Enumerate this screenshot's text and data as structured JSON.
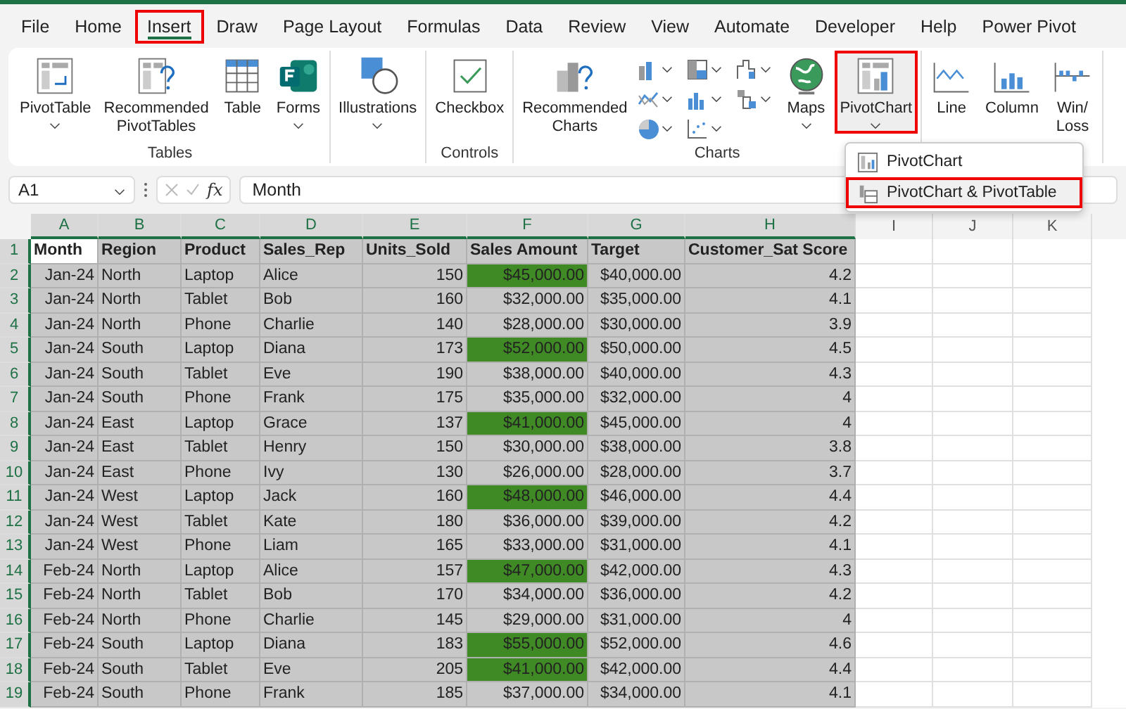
{
  "tabs": [
    {
      "label": "File",
      "selected": false,
      "annotated": false
    },
    {
      "label": "Home",
      "selected": false,
      "annotated": false
    },
    {
      "label": "Insert",
      "selected": true,
      "annotated": true
    },
    {
      "label": "Draw",
      "selected": false,
      "annotated": false
    },
    {
      "label": "Page Layout",
      "selected": false,
      "annotated": false
    },
    {
      "label": "Formulas",
      "selected": false,
      "annotated": false
    },
    {
      "label": "Data",
      "selected": false,
      "annotated": false
    },
    {
      "label": "Review",
      "selected": false,
      "annotated": false
    },
    {
      "label": "View",
      "selected": false,
      "annotated": false
    },
    {
      "label": "Automate",
      "selected": false,
      "annotated": false
    },
    {
      "label": "Developer",
      "selected": false,
      "annotated": false
    },
    {
      "label": "Help",
      "selected": false,
      "annotated": false
    },
    {
      "label": "Power Pivot",
      "selected": false,
      "annotated": false
    }
  ],
  "ribbon": {
    "groups": [
      {
        "label": "Tables",
        "buttons": [
          {
            "label": "PivotTable",
            "dropdown": true,
            "annotated": false
          },
          {
            "label": "Recommended PivotTables",
            "dropdown": false,
            "annotated": false
          },
          {
            "label": "Table",
            "dropdown": false,
            "annotated": false
          },
          {
            "label": "Forms",
            "dropdown": true,
            "annotated": false
          }
        ]
      },
      {
        "buttons": [
          {
            "label": "Illustrations",
            "dropdown": true,
            "annotated": false
          }
        ]
      },
      {
        "label": "Controls",
        "buttons": [
          {
            "label": "Checkbox",
            "dropdown": false,
            "annotated": false
          }
        ]
      },
      {
        "label": "Charts",
        "buttons": [
          {
            "label": "Recommended Charts",
            "dropdown": false,
            "annotated": false
          },
          {
            "kind": "chart-grid"
          },
          {
            "label": "Maps",
            "dropdown": true,
            "annotated": false
          },
          {
            "label": "PivotChart",
            "dropdown": true,
            "annotated": true
          }
        ]
      },
      {
        "buttons": [
          {
            "label": "Line",
            "dropdown": false,
            "annotated": false
          },
          {
            "label": "Column",
            "dropdown": false,
            "annotated": false
          },
          {
            "label": "Win/ Loss",
            "dropdown": false,
            "annotated": false
          }
        ]
      }
    ]
  },
  "menu": {
    "items": [
      {
        "label": "PivotChart",
        "selected": false,
        "annotated": false
      },
      {
        "label": "PivotChart & PivotTable",
        "selected": true,
        "annotated": true
      }
    ]
  },
  "formula_bar": {
    "name_box": "A1",
    "function_label": "fx",
    "formula": "Month"
  },
  "sheet": {
    "columns": [
      {
        "letter": "A",
        "selected": true,
        "numeric": true
      },
      {
        "letter": "B",
        "selected": true,
        "numeric": false
      },
      {
        "letter": "C",
        "selected": true,
        "numeric": false
      },
      {
        "letter": "D",
        "selected": true,
        "numeric": false
      },
      {
        "letter": "E",
        "selected": true,
        "numeric": true
      },
      {
        "letter": "F",
        "selected": true,
        "numeric": true
      },
      {
        "letter": "G",
        "selected": true,
        "numeric": true
      },
      {
        "letter": "H",
        "selected": true,
        "numeric": true
      },
      {
        "letter": "I",
        "selected": false
      },
      {
        "letter": "J",
        "selected": false
      },
      {
        "letter": "K",
        "selected": false
      }
    ],
    "rows": [
      {
        "number": "1",
        "selected": true,
        "header": true,
        "active_first": true,
        "highlight_sales": false,
        "cells": [
          "Month",
          "Region",
          "Product",
          "Sales_Rep",
          "Units_Sold",
          "Sales Amount",
          "Target",
          "Customer_Sat Score"
        ]
      },
      {
        "number": "2",
        "selected": true,
        "header": false,
        "active_first": false,
        "highlight_sales": true,
        "cells": [
          "Jan-24",
          "North",
          "Laptop",
          "Alice",
          "150",
          "$45,000.00",
          "$40,000.00",
          "4.2"
        ]
      },
      {
        "number": "3",
        "selected": true,
        "header": false,
        "active_first": false,
        "highlight_sales": false,
        "cells": [
          "Jan-24",
          "North",
          "Tablet",
          "Bob",
          "160",
          "$32,000.00",
          "$35,000.00",
          "4.1"
        ]
      },
      {
        "number": "4",
        "selected": true,
        "header": false,
        "active_first": false,
        "highlight_sales": false,
        "cells": [
          "Jan-24",
          "North",
          "Phone",
          "Charlie",
          "140",
          "$28,000.00",
          "$30,000.00",
          "3.9"
        ]
      },
      {
        "number": "5",
        "selected": true,
        "header": false,
        "active_first": false,
        "highlight_sales": true,
        "cells": [
          "Jan-24",
          "South",
          "Laptop",
          "Diana",
          "173",
          "$52,000.00",
          "$50,000.00",
          "4.5"
        ]
      },
      {
        "number": "6",
        "selected": true,
        "header": false,
        "active_first": false,
        "highlight_sales": false,
        "cells": [
          "Jan-24",
          "South",
          "Tablet",
          "Eve",
          "190",
          "$38,000.00",
          "$40,000.00",
          "4.3"
        ]
      },
      {
        "number": "7",
        "selected": true,
        "header": false,
        "active_first": false,
        "highlight_sales": false,
        "cells": [
          "Jan-24",
          "South",
          "Phone",
          "Frank",
          "175",
          "$35,000.00",
          "$32,000.00",
          "4"
        ]
      },
      {
        "number": "8",
        "selected": true,
        "header": false,
        "active_first": false,
        "highlight_sales": true,
        "cells": [
          "Jan-24",
          "East",
          "Laptop",
          "Grace",
          "137",
          "$41,000.00",
          "$45,000.00",
          "4"
        ]
      },
      {
        "number": "9",
        "selected": true,
        "header": false,
        "active_first": false,
        "highlight_sales": false,
        "cells": [
          "Jan-24",
          "East",
          "Tablet",
          "Henry",
          "150",
          "$30,000.00",
          "$38,000.00",
          "3.8"
        ]
      },
      {
        "number": "10",
        "selected": true,
        "header": false,
        "active_first": false,
        "highlight_sales": false,
        "cells": [
          "Jan-24",
          "East",
          "Phone",
          "Ivy",
          "130",
          "$26,000.00",
          "$28,000.00",
          "3.7"
        ]
      },
      {
        "number": "11",
        "selected": true,
        "header": false,
        "active_first": false,
        "highlight_sales": true,
        "cells": [
          "Jan-24",
          "West",
          "Laptop",
          "Jack",
          "160",
          "$48,000.00",
          "$46,000.00",
          "4.4"
        ]
      },
      {
        "number": "12",
        "selected": true,
        "header": false,
        "active_first": false,
        "highlight_sales": false,
        "cells": [
          "Jan-24",
          "West",
          "Tablet",
          "Kate",
          "180",
          "$36,000.00",
          "$39,000.00",
          "4.2"
        ]
      },
      {
        "number": "13",
        "selected": true,
        "header": false,
        "active_first": false,
        "highlight_sales": false,
        "cells": [
          "Jan-24",
          "West",
          "Phone",
          "Liam",
          "165",
          "$33,000.00",
          "$31,000.00",
          "4.1"
        ]
      },
      {
        "number": "14",
        "selected": true,
        "header": false,
        "active_first": false,
        "highlight_sales": true,
        "cells": [
          "Feb-24",
          "North",
          "Laptop",
          "Alice",
          "157",
          "$47,000.00",
          "$42,000.00",
          "4.3"
        ]
      },
      {
        "number": "15",
        "selected": true,
        "header": false,
        "active_first": false,
        "highlight_sales": false,
        "cells": [
          "Feb-24",
          "North",
          "Tablet",
          "Bob",
          "170",
          "$34,000.00",
          "$36,000.00",
          "4.2"
        ]
      },
      {
        "number": "16",
        "selected": true,
        "header": false,
        "active_first": false,
        "highlight_sales": false,
        "cells": [
          "Feb-24",
          "North",
          "Phone",
          "Charlie",
          "145",
          "$29,000.00",
          "$31,000.00",
          "4"
        ]
      },
      {
        "number": "17",
        "selected": true,
        "header": false,
        "active_first": false,
        "highlight_sales": true,
        "cells": [
          "Feb-24",
          "South",
          "Laptop",
          "Diana",
          "183",
          "$55,000.00",
          "$52,000.00",
          "4.6"
        ]
      },
      {
        "number": "18",
        "selected": true,
        "header": false,
        "active_first": false,
        "highlight_sales": true,
        "cells": [
          "Feb-24",
          "South",
          "Tablet",
          "Eve",
          "205",
          "$41,000.00",
          "$42,000.00",
          "4.4"
        ]
      },
      {
        "number": "19",
        "selected": true,
        "header": false,
        "active_first": false,
        "highlight_sales": false,
        "cells": [
          "Feb-24",
          "South",
          "Phone",
          "Frank",
          "185",
          "$37,000.00",
          "$34,000.00",
          "4.1"
        ]
      }
    ]
  }
}
